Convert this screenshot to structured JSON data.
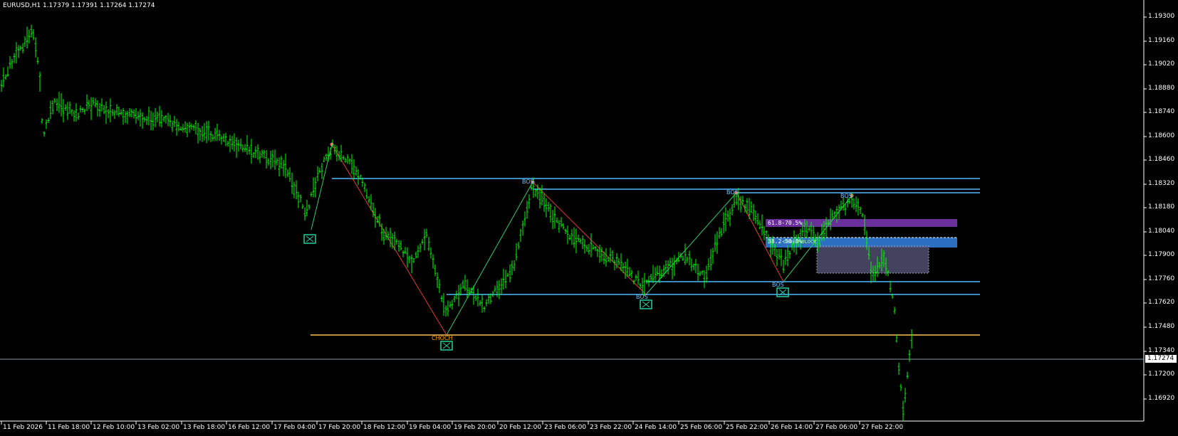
{
  "window": {
    "title": "EURUSD,H1  1.17379 1.17391 1.17264 1.17274"
  },
  "price_axis": {
    "labels": [
      "1.19300",
      "1.19160",
      "1.19020",
      "1.18880",
      "1.18740",
      "1.18600",
      "1.18460",
      "1.18320",
      "1.18180",
      "1.18040",
      "1.17900",
      "1.17760",
      "1.17620",
      "1.17480",
      "1.17340",
      "1.17200",
      "1.16920"
    ],
    "current_price": "1.17274"
  },
  "time_axis": {
    "labels": [
      "11 Feb 2026",
      "11 Feb 18:00",
      "12 Feb 10:00",
      "13 Feb 02:00",
      "13 Feb 18:00",
      "16 Feb 12:00",
      "17 Feb 04:00",
      "17 Feb 20:00",
      "18 Feb 12:00",
      "19 Feb 04:00",
      "19 Feb 20:00",
      "20 Feb 12:00",
      "23 Feb 06:00",
      "23 Feb 22:00",
      "24 Feb 14:00",
      "25 Feb 06:00",
      "25 Feb 22:00",
      "26 Feb 14:00",
      "27 Feb 06:00",
      "27 Feb 22:00"
    ]
  },
  "annotations": {
    "bos_labels": [
      "BOS",
      "BOS",
      "BOS",
      "BOS",
      "BOS"
    ],
    "choch_label": "CHOCH",
    "fib_zone_label": "61.8-70.5%",
    "ob_zone_label": "38.2-50.0%",
    "ob_zone_overlay_label": "ORDER BLOCK"
  },
  "colors": {
    "background": "#000000",
    "candle": "#00ff00",
    "level_line": "#4fb8ff",
    "choch_line": "#ffc34d",
    "bull_swing": "#2ecc71",
    "bear_swing": "#e53935",
    "fib_zone": "#6a2f9a",
    "ob_zone": "#2a6fc0",
    "fvg_zone": "#5a5a80",
    "marker": "#26d0a0"
  }
}
